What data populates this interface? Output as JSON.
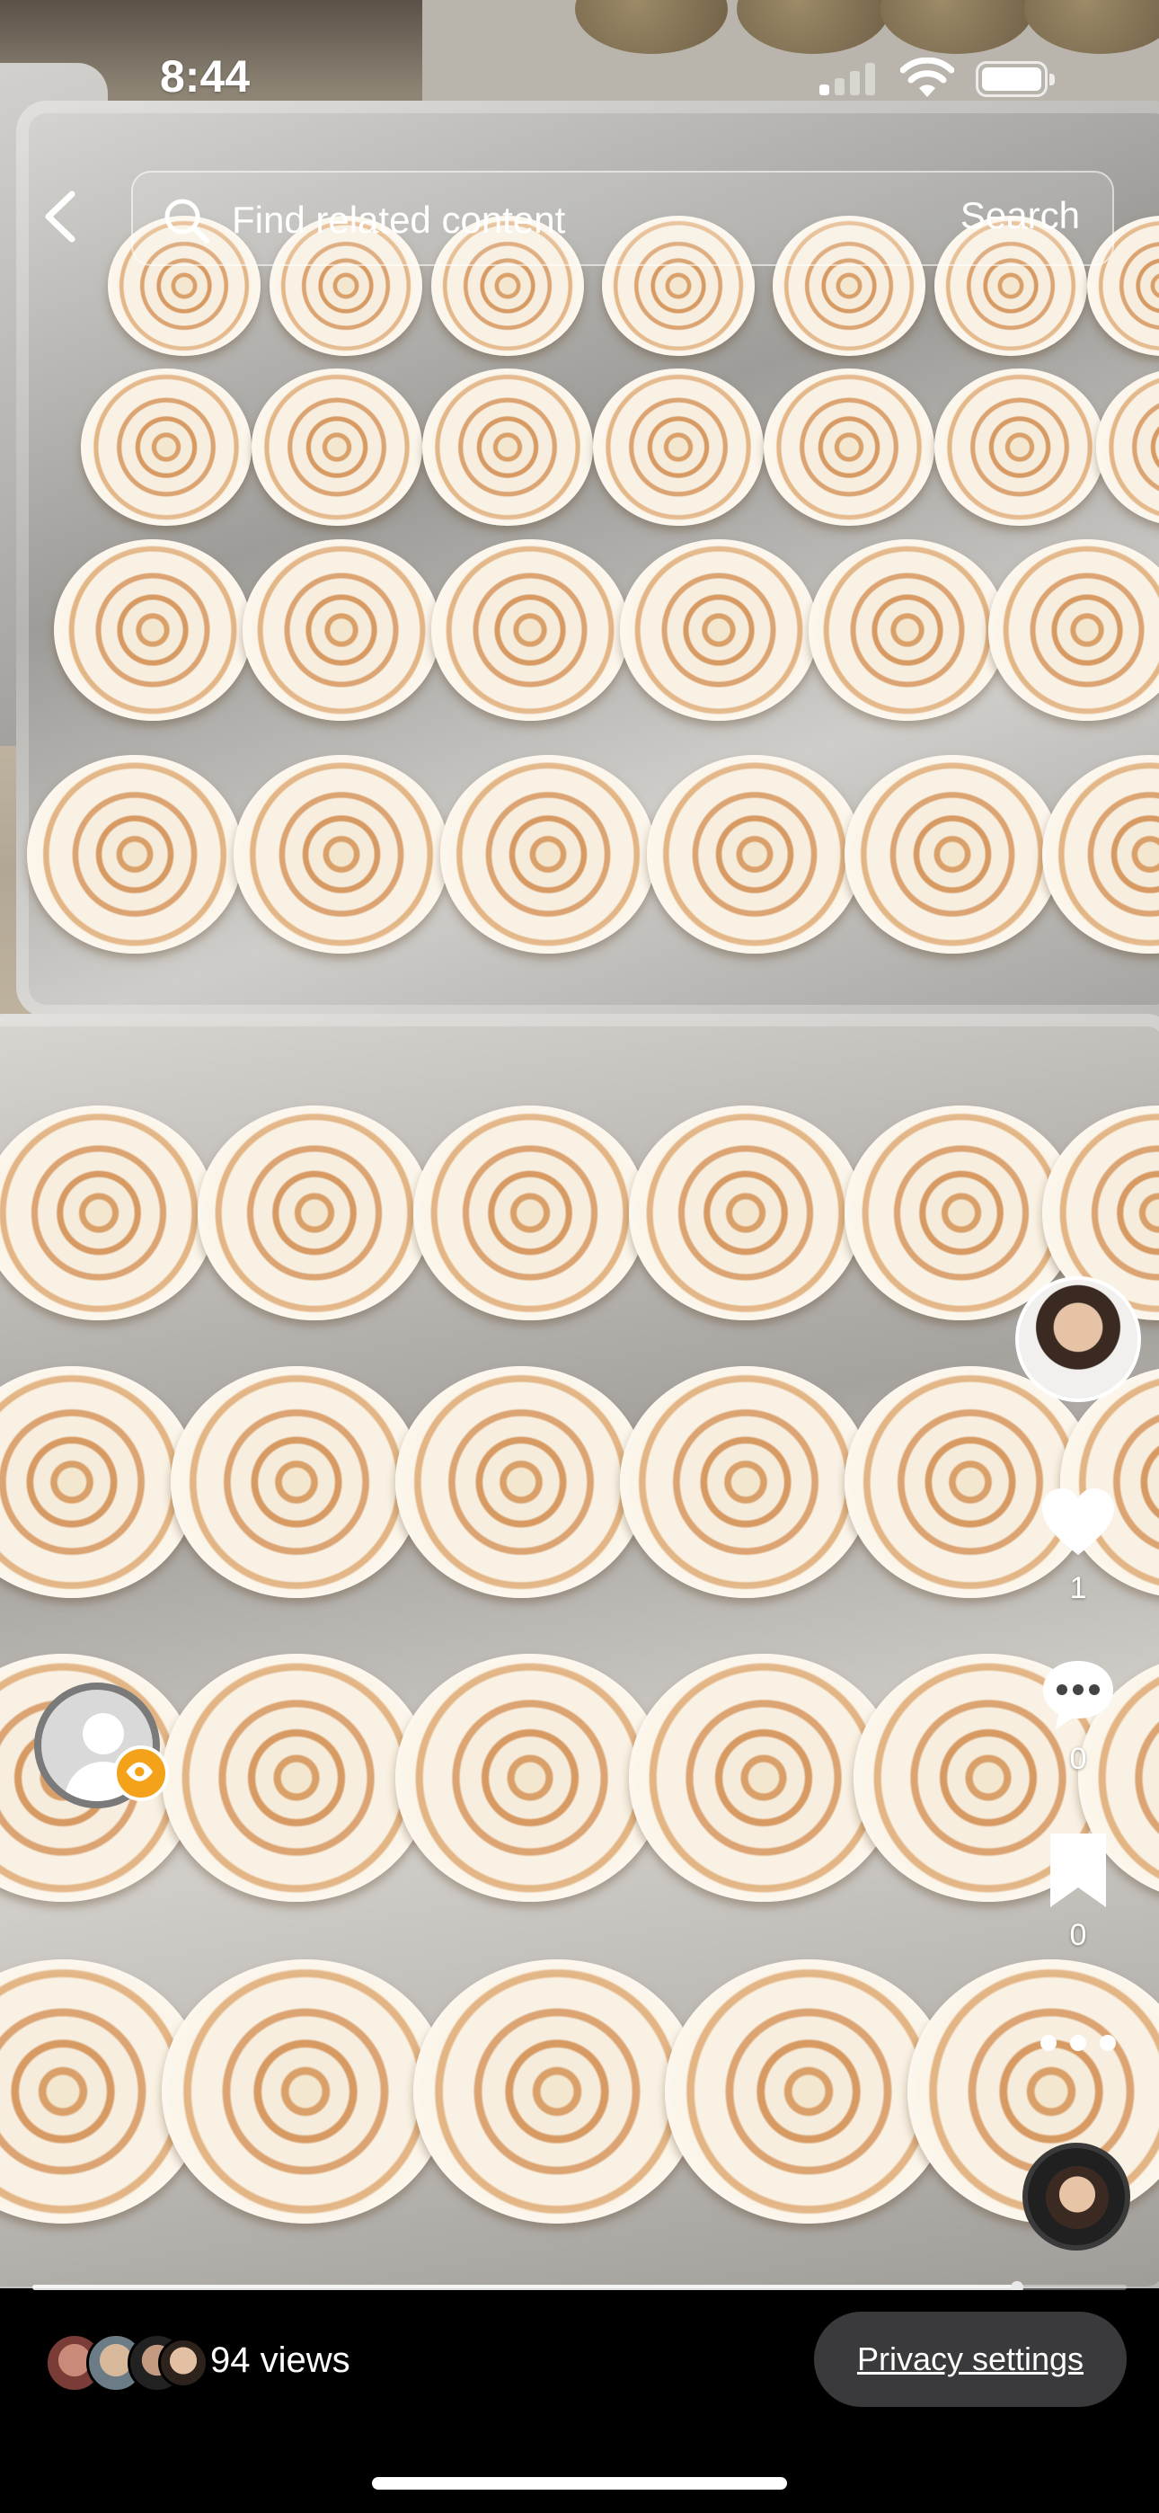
{
  "status_bar": {
    "time": "8:44"
  },
  "search": {
    "placeholder": "Find related content",
    "button_label": "Search"
  },
  "rail": {
    "likes_count": "1",
    "comments_count": "0",
    "saves_count": "0"
  },
  "video": {
    "progress": 0.9
  },
  "footer": {
    "views_label": "94 views",
    "privacy_label": "Privacy settings"
  },
  "colors": {
    "accent_badge": "#f3a21a",
    "privacy_button_bg": "#3a3a3c",
    "bar_bg": "#000000"
  },
  "icons": [
    "back-chevron-icon",
    "search-icon",
    "heart-icon",
    "comment-icon",
    "bookmark-icon",
    "more-icon",
    "eye-icon",
    "signal-icon",
    "wifi-icon",
    "battery-icon"
  ]
}
